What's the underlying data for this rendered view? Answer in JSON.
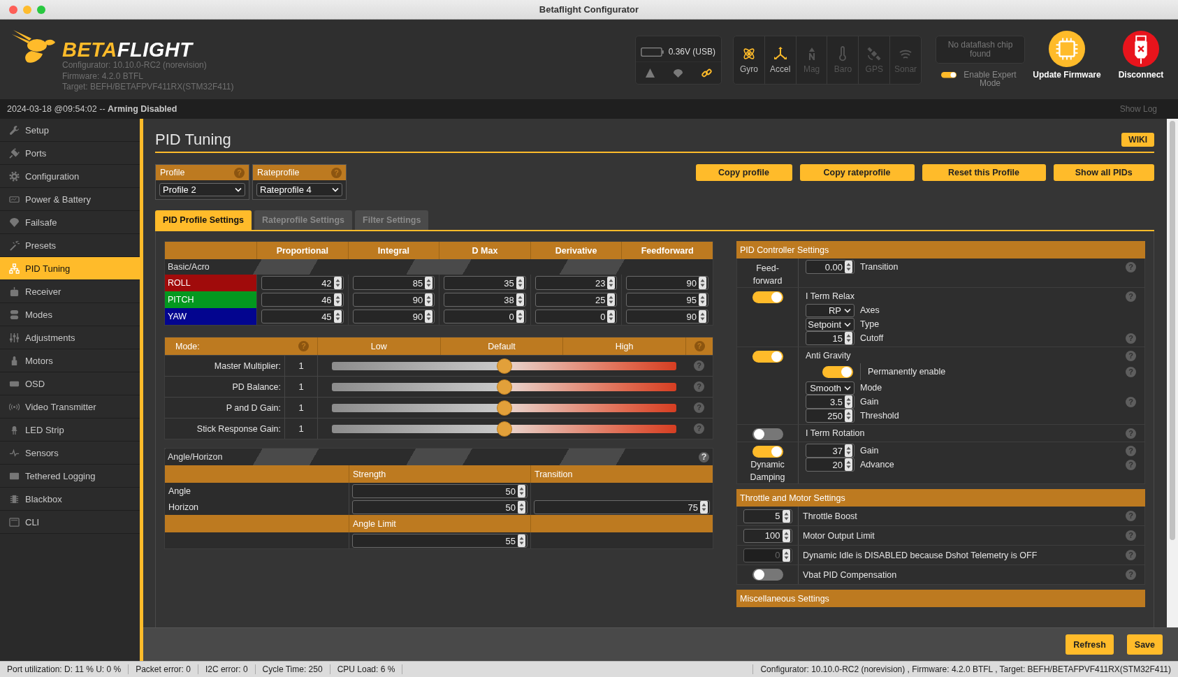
{
  "window": {
    "title": "Betaflight Configurator"
  },
  "header": {
    "logo": {
      "part_1": "BETA",
      "part_2": "FLIGHT"
    },
    "info": [
      "Configurator: 10.10.0-RC2 (norevision)",
      "Firmware: 4.2.0 BTFL",
      "Target: BEFH/BETAFPVF411RX(STM32F411)"
    ],
    "battery": {
      "reading": "0.36V (USB)"
    },
    "sensors": [
      {
        "label": "Gyro",
        "on": true
      },
      {
        "label": "Accel",
        "on": true
      },
      {
        "label": "Mag",
        "on": false
      },
      {
        "label": "Baro",
        "on": false
      },
      {
        "label": "GPS",
        "on": false
      },
      {
        "label": "Sonar",
        "on": false
      }
    ],
    "dataflash": "No dataflash chip found",
    "expert_mode": {
      "label": "Enable Expert Mode",
      "on": true
    },
    "buttons": [
      {
        "label": "Update Firmware",
        "kind": "update"
      },
      {
        "label": "Disconnect",
        "kind": "disconnect"
      }
    ]
  },
  "log_bar": {
    "message": "2024-03-18 @09:54:02 -- **Arming Disabled**",
    "show_log": "Show Log"
  },
  "sidebar": {
    "items": [
      {
        "label": "Setup",
        "selected": false
      },
      {
        "label": "Ports",
        "selected": false
      },
      {
        "label": "Configuration",
        "selected": false
      },
      {
        "label": "Power & Battery",
        "selected": false
      },
      {
        "label": "Failsafe",
        "selected": false
      },
      {
        "label": "Presets",
        "selected": false
      },
      {
        "label": "PID Tuning",
        "selected": true
      },
      {
        "label": "Receiver",
        "selected": false
      },
      {
        "label": "Modes",
        "selected": false
      },
      {
        "label": "Adjustments",
        "selected": false
      },
      {
        "label": "Motors",
        "selected": false
      },
      {
        "label": "OSD",
        "selected": false
      },
      {
        "label": "Video Transmitter",
        "selected": false
      },
      {
        "label": "LED Strip",
        "selected": false
      },
      {
        "label": "Sensors",
        "selected": false
      },
      {
        "label": "Tethered Logging",
        "selected": false
      },
      {
        "label": "Blackbox",
        "selected": false
      },
      {
        "label": "CLI",
        "selected": false
      }
    ]
  },
  "page": {
    "title": "PID Tuning",
    "wiki": "WIKI",
    "profiles": [
      {
        "label": "Profile",
        "help": "?",
        "value": "Profile 2"
      },
      {
        "label": "Rateprofile",
        "help": "?",
        "value": "Rateprofile 4"
      }
    ],
    "actions": [
      "Copy profile",
      "Copy rateprofile",
      "Reset this Profile",
      "Show all PIDs"
    ],
    "tabs": [
      {
        "label": "PID Profile Settings",
        "selected": true
      },
      {
        "label": "Rateprofile Settings",
        "selected": false
      },
      {
        "label": "Filter Settings",
        "selected": false
      }
    ],
    "pid_table": {
      "columns": [
        "Proportional",
        "Integral",
        "D Max",
        "Derivative",
        "Feedforward"
      ],
      "section": "Basic/Acro",
      "rows": [
        {
          "axis": "ROLL",
          "color": "#a00b0b",
          "values": [
            "42",
            "85",
            "35",
            "23",
            "90"
          ]
        },
        {
          "axis": "PITCH",
          "color": "#03981f",
          "values": [
            "46",
            "90",
            "38",
            "25",
            "95"
          ]
        },
        {
          "axis": "YAW",
          "color": "#03058f",
          "values": [
            "45",
            "90",
            "0",
            "0",
            "90"
          ]
        }
      ]
    },
    "sliders": {
      "mode": "Mode:",
      "mode_help": "?",
      "columns": [
        "Low",
        "Default",
        "High"
      ],
      "column_help": "?",
      "rows": [
        {
          "label": "Master Multiplier:",
          "value": "1",
          "level": 0.5,
          "help": "?"
        },
        {
          "label": "PD Balance:",
          "value": "1",
          "level": 0.5,
          "help": "?"
        },
        {
          "label": "P and D Gain:",
          "value": "1",
          "level": 0.5,
          "help": "?"
        },
        {
          "label": "Stick Response Gain:",
          "value": "1",
          "level": 0.5,
          "help": "?"
        }
      ]
    },
    "angle_horizon": {
      "title": "Angle/Horizon",
      "help": "?",
      "columns": [
        "Strength",
        "Transition"
      ],
      "rows": [
        {
          "label": "Angle",
          "strength": "50"
        },
        {
          "label": "Horizon",
          "strength": "50",
          "transition": "75"
        }
      ],
      "limit_label": "Angle Limit",
      "limit": "55"
    },
    "pid_controller": {
      "title": "PID Controller Settings",
      "groups": [
        {
          "side": {
            "label": "Feed-forward"
          },
          "rows": [
            {
              "kind": "number",
              "value": "0.00",
              "label": "Transition",
              "help": "?"
            }
          ]
        },
        {
          "side": {
            "on": true
          },
          "title": "I Term Relax",
          "help": "?",
          "rows": [
            {
              "kind": "select",
              "value": "RP",
              "label": "Axes"
            },
            {
              "kind": "select",
              "value": "Setpoint",
              "label": "Type"
            },
            {
              "kind": "number",
              "value": "15",
              "label": "Cutoff",
              "help": "?"
            }
          ]
        },
        {
          "side": {
            "on": true
          },
          "title": "Anti Gravity",
          "help": "?",
          "rows": [
            {
              "kind": "toggle",
              "on": true,
              "label": "Permanently enable",
              "help": "?"
            },
            {
              "kind": "select",
              "value": "Smooth",
              "label": "Mode"
            },
            {
              "kind": "number",
              "value": "3.5",
              "label": "Gain",
              "help": "?"
            },
            {
              "kind": "number",
              "value": "250",
              "label": "Threshold"
            }
          ]
        },
        {
          "side": {
            "on": false
          },
          "title": "I Term Rotation",
          "help": "?"
        },
        {
          "side": {
            "on": true,
            "label": "Dynamic Damping"
          },
          "rows": [
            {
              "kind": "number",
              "value": "37",
              "label": "Gain",
              "help": "?"
            },
            {
              "kind": "number",
              "value": "20",
              "label": "Advance",
              "help": "?"
            }
          ]
        }
      ]
    },
    "throttle": {
      "title": "Throttle and Motor Settings",
      "rows": [
        {
          "kind": "number",
          "value": "5",
          "label": "Throttle Boost",
          "disabled": false,
          "help": "?"
        },
        {
          "kind": "number",
          "value": "100",
          "label": "Motor Output Limit",
          "disabled": false,
          "help": "?"
        },
        {
          "kind": "number",
          "value": "0",
          "label": "Dynamic Idle is DISABLED because Dshot Telemetry is OFF",
          "disabled": true,
          "help": "?"
        },
        {
          "kind": "toggle",
          "on": false,
          "label": "Vbat PID Compensation",
          "help": "?"
        }
      ]
    },
    "misc": {
      "title": "Miscellaneous Settings"
    }
  },
  "footer": {
    "buttons": [
      "Refresh",
      "Save"
    ]
  },
  "status_bar": {
    "items": [
      "Port utilization: D: 11 % U: 0 %",
      "Packet error: 0",
      "I2C error: 0",
      "Cycle Time: 250",
      "CPU Load: 6 %"
    ],
    "right": "Configurator: 10.10.0-RC2 (norevision) , Firmware: 4.2.0 BTFL , Target: BEFH/BETAFPVF411RX(STM32F411)"
  }
}
